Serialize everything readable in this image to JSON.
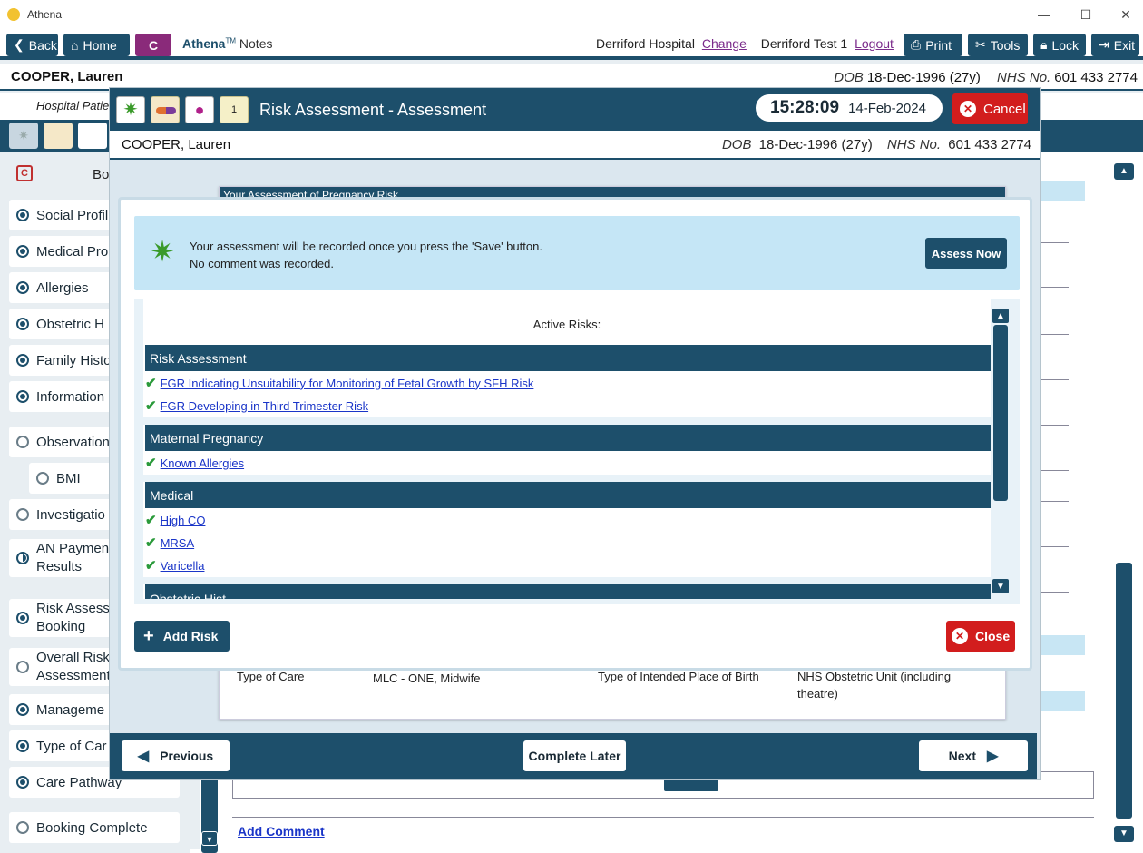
{
  "window": {
    "title": "Athena"
  },
  "nav": {
    "back": "Back",
    "home": "Home",
    "c_badge": "C",
    "app_name": "Athena",
    "app_tm": "TM",
    "app_suffix": "Notes",
    "hospital": "Derriford Hospital",
    "change": "Change",
    "user": "Derriford Test 1",
    "logout": "Logout",
    "print": "Print",
    "tools": "Tools",
    "lock": "Lock",
    "exit": "Exit"
  },
  "patient": {
    "name": "COOPER, Lauren",
    "dob_label": "DOB",
    "dob": "18-Dec-1996 (27y)",
    "nhs_label": "NHS No.",
    "nhs": "601 433 2774",
    "subheader": "Hospital Patie"
  },
  "sidebar": {
    "header": "Bo",
    "items": [
      {
        "label": "Social Profil",
        "state": "full"
      },
      {
        "label": "Medical Pro",
        "state": "full"
      },
      {
        "label": "Allergies",
        "state": "full"
      },
      {
        "label": "Obstetric H",
        "state": "full"
      },
      {
        "label": "Family Histo",
        "state": "full"
      },
      {
        "label": "Information",
        "state": "full"
      },
      {
        "label": "Observation",
        "state": "empty"
      },
      {
        "label": "BMI",
        "state": "empty"
      },
      {
        "label": "Investigatio",
        "state": "empty"
      },
      {
        "label": "AN Paymen",
        "label2": "Results",
        "state": "half"
      },
      {
        "label": "Risk Assess",
        "label2": "Booking",
        "state": "full"
      },
      {
        "label": "Overall Risk",
        "label2": "Assessment",
        "state": "empty"
      },
      {
        "label": "Manageme",
        "state": "full"
      },
      {
        "label": "Type of Car",
        "state": "full"
      },
      {
        "label": "Care Pathway",
        "state": "full"
      },
      {
        "label": "Booking Complete",
        "state": "empty"
      }
    ]
  },
  "modal": {
    "title": "Risk Assessment - Assessment",
    "time": "15:28:09",
    "date": "14-Feb-2024",
    "cancel": "Cancel",
    "bg_section": "Your Assessment of Pregnancy Risk",
    "info_line1": "Your assessment will be recorded once you press the 'Save' button.",
    "info_line2": "No comment was recorded.",
    "assess_now": "Assess Now",
    "active_risks": "Active Risks:",
    "groups": [
      {
        "header": "Risk Assessment",
        "items": [
          "FGR Indicating Unsuitability for Monitoring of Fetal Growth by SFH Risk",
          "FGR Developing in Third Trimester Risk"
        ]
      },
      {
        "header": "Maternal Pregnancy",
        "items": [
          "Known Allergies"
        ]
      },
      {
        "header": "Medical",
        "items": [
          "High CO",
          "MRSA",
          "Varicella"
        ]
      },
      {
        "header": "Obstetric Hist",
        "items": []
      }
    ],
    "add_risk": "Add Risk",
    "close": "Close",
    "bg_type_of_care_label": "Type of Care",
    "bg_type_of_care_value": "MLC - ONE, Midwife",
    "bg_place_label": "Type of  Intended Place of Birth",
    "bg_place_value1": "NHS Obstetric Unit (including",
    "bg_place_value2": "theatre)",
    "previous": "Previous",
    "complete_later": "Complete Later",
    "next": "Next"
  },
  "background": {
    "add_comment": "Add Comment"
  },
  "colors": {
    "primary": "#1d4f6b",
    "danger": "#d21d1d",
    "info": "#c5e6f6",
    "check": "#2a9a3a",
    "link": "#1a35c8"
  }
}
